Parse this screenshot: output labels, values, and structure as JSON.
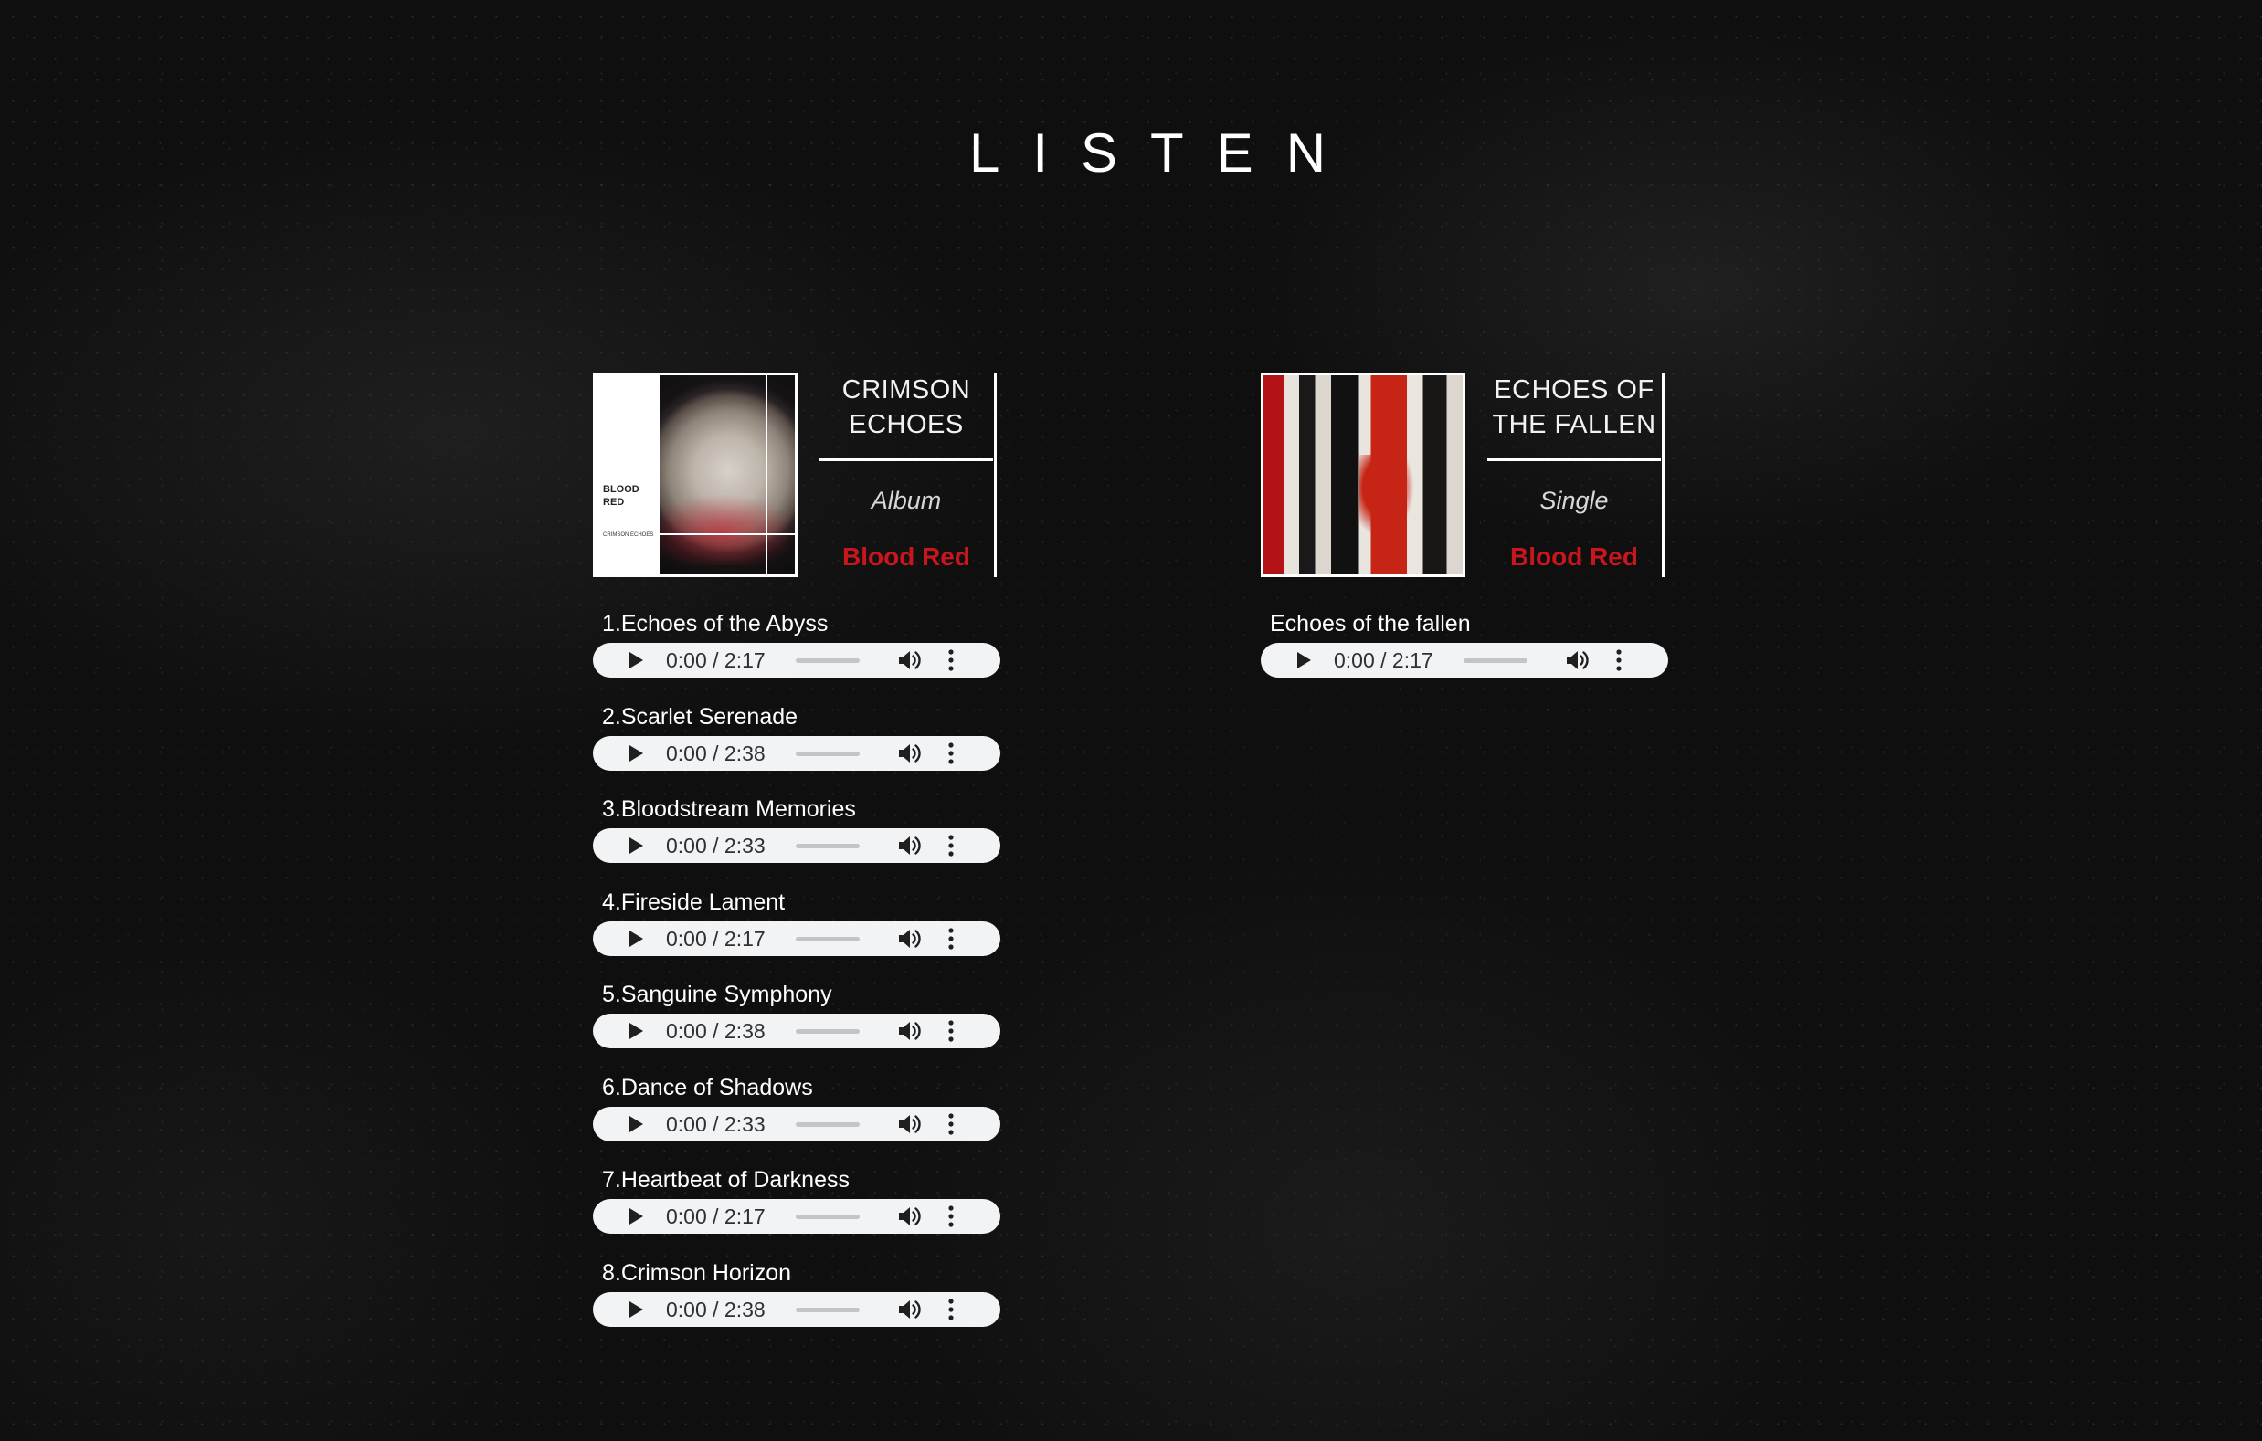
{
  "page": {
    "title": "LISTEN"
  },
  "colors": {
    "background": "#0f0f0f",
    "accent": "#c8161d",
    "player_bg": "#f1f3f4"
  },
  "releases": [
    {
      "name": "CRIMSON ECHOES",
      "type": "Album",
      "artist": "Blood Red",
      "cover": {
        "text_main": "BLOOD RED",
        "text_sub": "CRIMSON ECHOES"
      },
      "tracks": [
        {
          "title": "1.Echoes of the Abyss",
          "time": "0:00 / 2:17"
        },
        {
          "title": "2.Scarlet Serenade",
          "time": "0:00 / 2:38"
        },
        {
          "title": "3.Bloodstream Memories",
          "time": "0:00 / 2:33"
        },
        {
          "title": "4.Fireside Lament",
          "time": "0:00 / 2:17"
        },
        {
          "title": "5.Sanguine Symphony",
          "time": "0:00 / 2:38"
        },
        {
          "title": "6.Dance of Shadows",
          "time": "0:00 / 2:33"
        },
        {
          "title": "7.Heartbeat of Darkness",
          "time": "0:00 / 2:17"
        },
        {
          "title": "8.Crimson Horizon",
          "time": "0:00 / 2:38"
        }
      ]
    },
    {
      "name": "ECHOES OF THE FALLEN",
      "type": "Single",
      "artist": "Blood Red",
      "tracks": [
        {
          "title": "Echoes of the fallen",
          "time": "0:00 / 2:17"
        }
      ]
    }
  ],
  "player": {
    "volume_level": 0.35,
    "icons": {
      "play": "play-icon",
      "volume": "volume-icon",
      "menu": "more-vertical-icon"
    }
  }
}
